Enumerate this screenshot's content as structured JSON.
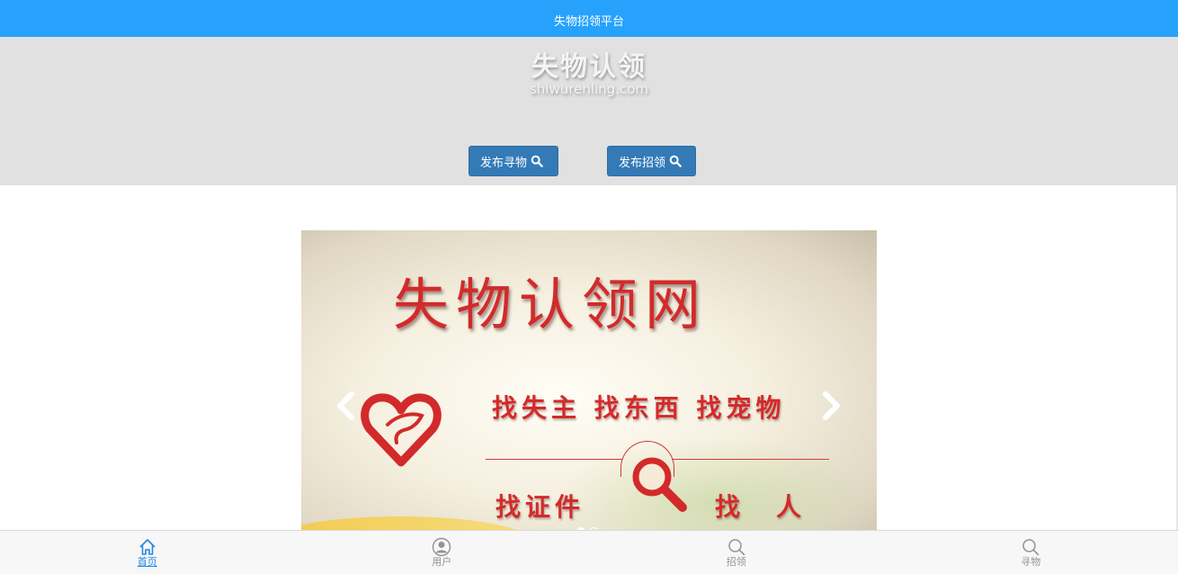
{
  "header": {
    "title": "失物招领平台"
  },
  "hero": {
    "logo_title": "失物认领",
    "logo_subtitle": "shiwurenling.com",
    "publish_lost_label": "发布寻物",
    "publish_found_label": "发布招领"
  },
  "carousel": {
    "slide_title": "失物认领网",
    "slide_line1": "找失主 找东西 找宠物",
    "slide_line2": "找证件",
    "slide_line3": "找人",
    "active_index": 0,
    "slide_count": 2
  },
  "tabbar": {
    "items": [
      {
        "label": "首页",
        "icon": "home-icon"
      },
      {
        "label": "用户",
        "icon": "user-icon"
      },
      {
        "label": "招领",
        "icon": "search-icon"
      },
      {
        "label": "寻物",
        "icon": "search-icon"
      }
    ],
    "active": 0
  },
  "colors": {
    "topbar": "#26a2fd",
    "hero_bg": "#e1e1e1",
    "button_primary": "#337ab7",
    "active_tab": "#1e88e5",
    "slide_red": "#d32a2a"
  }
}
